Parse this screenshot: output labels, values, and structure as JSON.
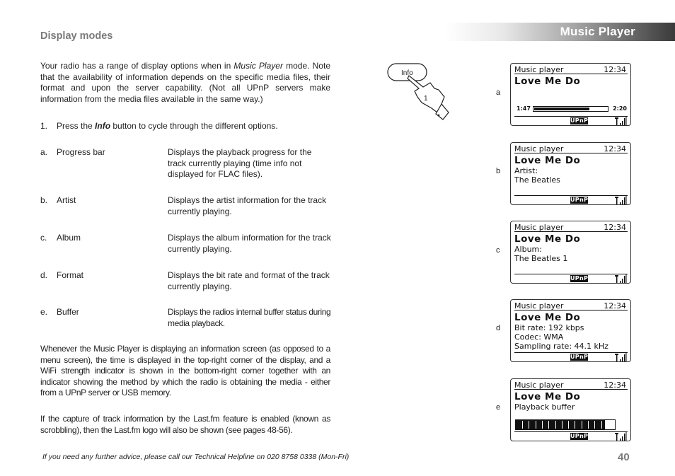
{
  "header": {
    "title": "Music Player"
  },
  "section_title": "Display modes",
  "intro": {
    "before_italic": "Your radio has a range of display options when in ",
    "italic": "Music Player",
    "after_italic": " mode. Note that the availability of information depends on the specific media files, their format and upon the server capability. (Not all UPnP servers make information from the media files available in the same way.)"
  },
  "step": {
    "number": "1.",
    "before": "Press the ",
    "bold_italic": "Info",
    "after": " button to cycle through the different options."
  },
  "modes": [
    {
      "letter": "a.",
      "name": "Progress bar",
      "description": "Displays the playback progress for the track currently playing (time info not displayed for FLAC files)."
    },
    {
      "letter": "b.",
      "name": "Artist",
      "description": "Displays the artist information for the track currently playing."
    },
    {
      "letter": "c.",
      "name": "Album",
      "description": "Displays the album information for the track currently playing."
    },
    {
      "letter": "d.",
      "name": "Format",
      "description": "Displays the bit rate and format of the track currently playing."
    },
    {
      "letter": "e.",
      "name": "Buffer",
      "description": "Displays the radios internal buffer status during media playback."
    }
  ],
  "paragraph2": "Whenever the Music Player is displaying an information screen (as opposed to a menu screen), the time is displayed in the top-right corner of the display, and a WiFi strength indicator is shown in the bottom-right corner together with an indicator showing the method by which the radio is obtaining the media - either from a UPnP server or USB memory.",
  "paragraph3": "If the capture of track information by the Last.fm feature is enabled (known as scrobbling), then the Last.fm logo will also be shown (see pages 48-56).",
  "illustration": {
    "button_label": "Info",
    "press_count": "1"
  },
  "screens": [
    {
      "label": "a",
      "header": "Music player",
      "time": "12:34",
      "track": "Love Me Do",
      "elapsed": "1:47",
      "total": "2:20",
      "progress_fraction": 0.76,
      "source": "UPnP"
    },
    {
      "label": "b",
      "header": "Music player",
      "time": "12:34",
      "track": "Love Me Do",
      "lines": [
        "Artist:",
        "The Beatles"
      ],
      "source": "UPnP"
    },
    {
      "label": "c",
      "header": "Music player",
      "time": "12:34",
      "track": "Love Me Do",
      "lines": [
        "Album:",
        "The Beatles 1"
      ],
      "source": "UPnP"
    },
    {
      "label": "d",
      "header": "Music player",
      "time": "12:34",
      "track": "Love Me Do",
      "lines": [
        "Bit rate: 192 kbps",
        "Codec: WMA",
        "Sampling rate: 44.1 kHz"
      ],
      "source": "UPnP"
    },
    {
      "label": "e",
      "header": "Music player",
      "time": "12:34",
      "track": "Love Me Do",
      "lines": [
        "Playback buffer"
      ],
      "buffer_fraction": 0.9,
      "source": "UPnP"
    }
  ],
  "footer": {
    "note": "If you need any further advice, please call our Technical Helpline on 020 8758 0338 (Mon-Fri)",
    "page_number": "40"
  }
}
